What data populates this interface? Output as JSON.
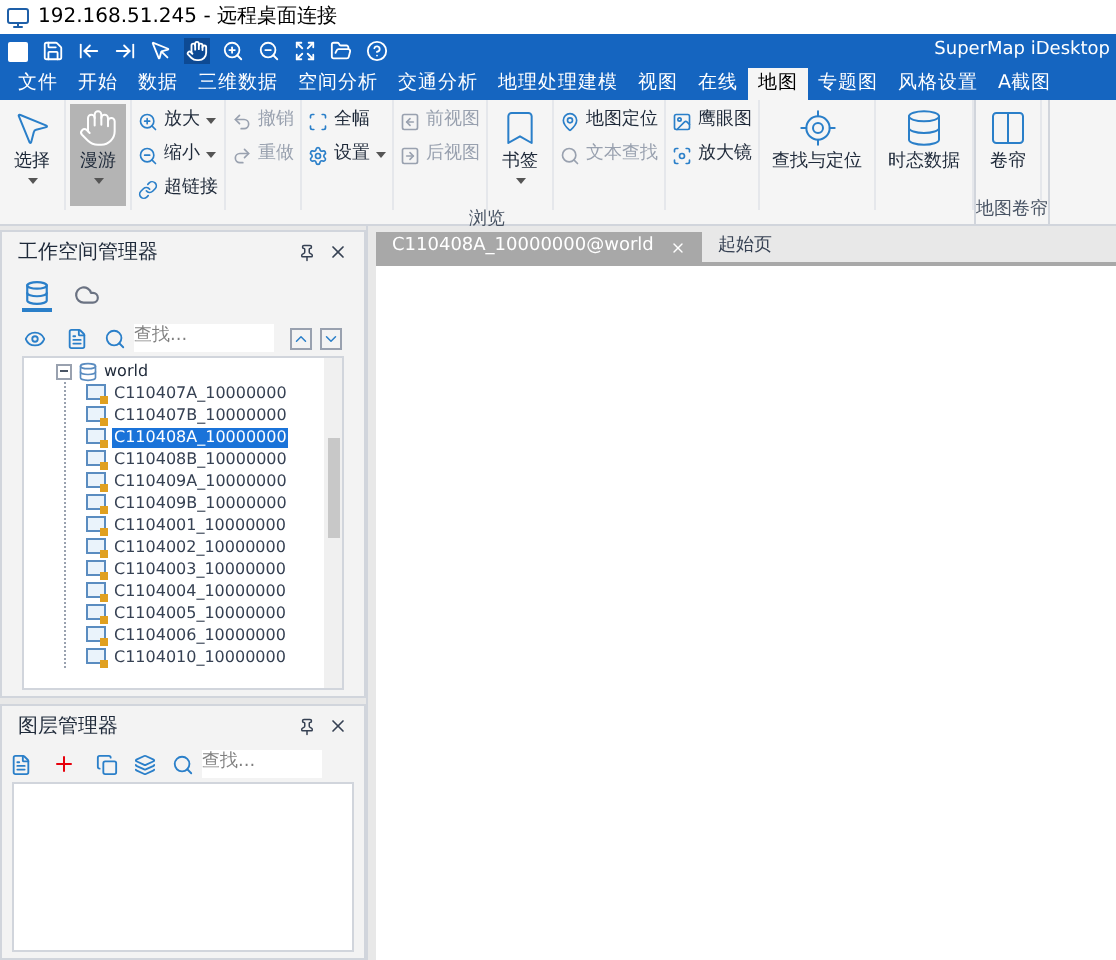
{
  "window": {
    "title": "192.168.51.245 - 远程桌面连接"
  },
  "app_name": "SuperMap iDesktop",
  "menu_tabs": [
    {
      "label": "文件",
      "selected": false
    },
    {
      "label": "开始",
      "selected": false
    },
    {
      "label": "数据",
      "selected": false
    },
    {
      "label": "三维数据",
      "selected": false
    },
    {
      "label": "空间分析",
      "selected": false
    },
    {
      "label": "交通分析",
      "selected": false
    },
    {
      "label": "地理处理建模",
      "selected": false
    },
    {
      "label": "视图",
      "selected": false
    },
    {
      "label": "在线",
      "selected": false
    },
    {
      "label": "地图",
      "selected": true
    },
    {
      "label": "专题图",
      "selected": false
    },
    {
      "label": "风格设置",
      "selected": false
    },
    {
      "label": "A截图",
      "selected": false
    }
  ],
  "ribbon": {
    "groups": [
      {
        "label": "浏览",
        "columns": [
          {
            "kind": "large",
            "items": [
              {
                "label": "选择",
                "dropdown": true,
                "selected": false,
                "disabled": false
              }
            ]
          },
          {
            "kind": "large",
            "items": [
              {
                "label": "漫游",
                "dropdown": true,
                "selected": true,
                "disabled": false
              }
            ]
          },
          {
            "kind": "stack",
            "items": [
              {
                "label": "放大",
                "dropdown": true,
                "selected": false,
                "disabled": false
              },
              {
                "label": "缩小",
                "dropdown": true,
                "selected": false,
                "disabled": false
              },
              {
                "label": "超链接",
                "dropdown": false,
                "selected": false,
                "disabled": false
              }
            ]
          },
          {
            "kind": "stack",
            "items": [
              {
                "label": "撤销",
                "dropdown": false,
                "selected": false,
                "disabled": true
              },
              {
                "label": "重做",
                "dropdown": false,
                "selected": false,
                "disabled": true
              }
            ]
          },
          {
            "kind": "stack",
            "items": [
              {
                "label": "全幅",
                "dropdown": false,
                "selected": false,
                "disabled": false
              },
              {
                "label": "设置",
                "dropdown": true,
                "selected": false,
                "disabled": false
              }
            ]
          },
          {
            "kind": "stack",
            "items": [
              {
                "label": "前视图",
                "dropdown": false,
                "selected": false,
                "disabled": true
              },
              {
                "label": "后视图",
                "dropdown": false,
                "selected": false,
                "disabled": true
              }
            ]
          },
          {
            "kind": "large",
            "items": [
              {
                "label": "书签",
                "dropdown": true,
                "selected": false,
                "disabled": false
              }
            ]
          },
          {
            "kind": "stack",
            "items": [
              {
                "label": "地图定位",
                "dropdown": false,
                "selected": false,
                "disabled": false
              },
              {
                "label": "文本查找",
                "dropdown": false,
                "selected": false,
                "disabled": true
              }
            ]
          },
          {
            "kind": "stack",
            "items": [
              {
                "label": "鹰眼图",
                "dropdown": false,
                "selected": false,
                "disabled": false
              },
              {
                "label": "放大镜",
                "dropdown": false,
                "selected": false,
                "disabled": false
              }
            ]
          },
          {
            "kind": "large",
            "items": [
              {
                "label": "查找与定位",
                "dropdown": false,
                "selected": false,
                "disabled": false
              }
            ]
          },
          {
            "kind": "large",
            "items": [
              {
                "label": "时态数据",
                "dropdown": false,
                "selected": false,
                "disabled": false
              }
            ]
          }
        ]
      },
      {
        "label": "地图卷帘",
        "columns": [
          {
            "kind": "large",
            "items": [
              {
                "label": "卷帘",
                "dropdown": false,
                "selected": false,
                "disabled": false
              }
            ]
          }
        ]
      }
    ]
  },
  "workspace_panel": {
    "title": "工作空间管理器",
    "view_tabs": [
      {
        "selected": true
      },
      {
        "selected": false
      }
    ],
    "search": {
      "placeholder": "查找..."
    },
    "tree": [
      {
        "label": "world",
        "expanded": true,
        "children": [
          {
            "label": "C110407A_10000000",
            "selected": false
          },
          {
            "label": "C110407B_10000000",
            "selected": false
          },
          {
            "label": "C110408A_10000000",
            "selected": true
          },
          {
            "label": "C110408B_10000000",
            "selected": false
          },
          {
            "label": "C110409A_10000000",
            "selected": false
          },
          {
            "label": "C110409B_10000000",
            "selected": false
          },
          {
            "label": "C1104001_10000000",
            "selected": false
          },
          {
            "label": "C1104002_10000000",
            "selected": false
          },
          {
            "label": "C1104003_10000000",
            "selected": false
          },
          {
            "label": "C1104004_10000000",
            "selected": false
          },
          {
            "label": "C1104005_10000000",
            "selected": false
          },
          {
            "label": "C1104006_10000000",
            "selected": false
          },
          {
            "label": "C1104010_10000000",
            "selected": false
          }
        ]
      }
    ]
  },
  "layer_panel": {
    "title": "图层管理器",
    "search": {
      "placeholder": "查找..."
    }
  },
  "document_tabs": [
    {
      "label": "C110408A_10000000@world",
      "selected": true,
      "closable": true
    },
    {
      "label": "起始页",
      "selected": false,
      "closable": false
    }
  ]
}
